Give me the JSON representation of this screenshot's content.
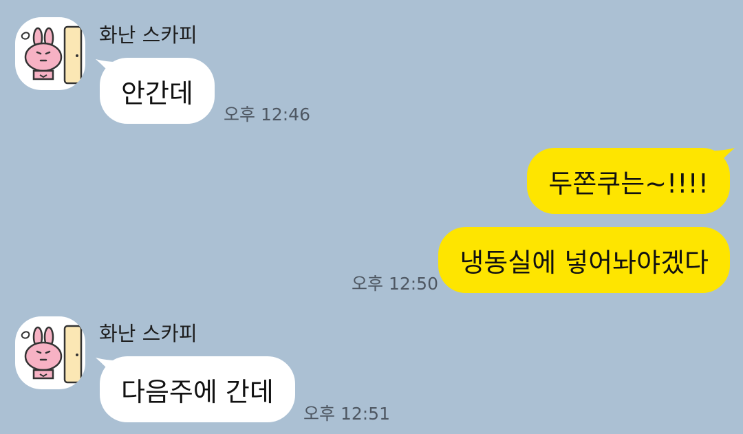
{
  "colors": {
    "background": "#abc0d3",
    "incoming_bubble": "#ffffff",
    "outgoing_bubble": "#fee500"
  },
  "messages": [
    {
      "direction": "incoming",
      "sender": "화난 스카피",
      "avatar_icon": "angry-bunny-avatar-icon",
      "text": "안간데",
      "time": "오후 12:46"
    },
    {
      "direction": "outgoing",
      "text": "두쫀쿠는~!!!!"
    },
    {
      "direction": "outgoing",
      "text": "냉동실에 넣어놔야겠다",
      "time": "오후 12:50"
    },
    {
      "direction": "incoming",
      "sender": "화난 스카피",
      "avatar_icon": "angry-bunny-avatar-icon",
      "text": "다음주에 간데",
      "time": "오후 12:51"
    }
  ]
}
